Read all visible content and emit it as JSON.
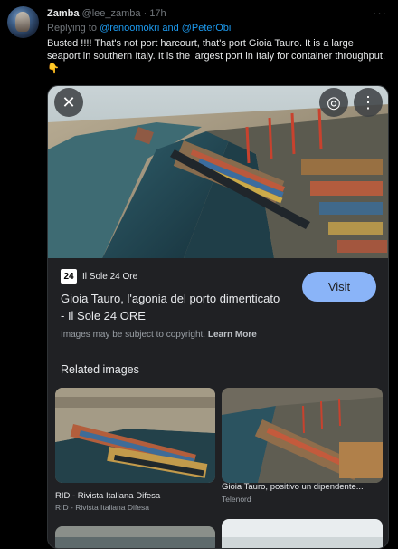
{
  "tweet": {
    "display_name": "Zamba",
    "handle": "@lee_zamba",
    "separator": "·",
    "time": "17h",
    "replying_prefix": "Replying to ",
    "replying_to": "@renoomokri and @PeterObi",
    "text": "Busted !!!! That's not port harcourt, that's port Gioia Tauro. It is a large seaport in southern Italy. It is the largest port in Italy for container throughput. 👇",
    "more_icon": "···"
  },
  "result": {
    "close_icon": "✕",
    "lens_icon": "◎",
    "more_icon": "⋮",
    "source_logo": "24",
    "source_name": "Il Sole 24 Ore",
    "title": "Gioia Tauro, l'agonia del porto dimenticato - Il Sole 24 ORE",
    "visit_label": "Visit",
    "copyright_text": "Images may be subject to copyright.",
    "learn_more": "Learn More"
  },
  "related": {
    "heading": "Related images",
    "items": [
      {
        "caption": "RID - Rivista Italiana Difesa",
        "source": "RID - Rivista Italiana Difesa"
      },
      {
        "caption": "Gioia Tauro, positivo un dipendente...",
        "source": "Telenord"
      }
    ]
  },
  "colors": {
    "background": "#000000",
    "link": "#1d9bf0",
    "visit_button": "#8ab4f8",
    "card_bg": "#202124"
  }
}
